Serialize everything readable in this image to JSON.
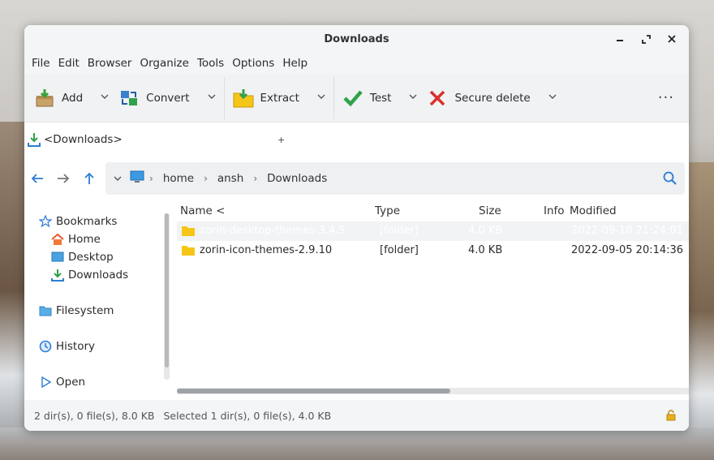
{
  "window": {
    "title": "Downloads"
  },
  "menu": [
    "File",
    "Edit",
    "Browser",
    "Organize",
    "Tools",
    "Options",
    "Help"
  ],
  "toolbar": {
    "add": "Add",
    "convert": "Convert",
    "extract": "Extract",
    "test": "Test",
    "secure_delete": "Secure delete",
    "more": "···"
  },
  "pathbar": {
    "label": "<Downloads>",
    "plus": "+"
  },
  "address": {
    "crumbs": [
      "home",
      "ansh",
      "Downloads"
    ]
  },
  "sidebar": {
    "bookmarks": "Bookmarks",
    "home": "Home",
    "desktop": "Desktop",
    "downloads": "Downloads",
    "filesystem": "Filesystem",
    "history": "History",
    "open": "Open"
  },
  "columns": {
    "name": "Name <",
    "type": "Type",
    "size": "Size",
    "info": "Info",
    "modified": "Modified"
  },
  "files": [
    {
      "name": "zorin-desktop-themes-3.4.5",
      "type": "[folder]",
      "size": "4.0 KB",
      "info": "",
      "modified": "2022-09-10 21:24:01"
    },
    {
      "name": "zorin-icon-themes-2.9.10",
      "type": "[folder]",
      "size": "4.0 KB",
      "info": "",
      "modified": "2022-09-05 20:14:36"
    }
  ],
  "status": {
    "summary": "2 dir(s), 0 file(s), 8.0 KB",
    "selected": "Selected 1 dir(s), 0 file(s), 4.0 KB"
  }
}
